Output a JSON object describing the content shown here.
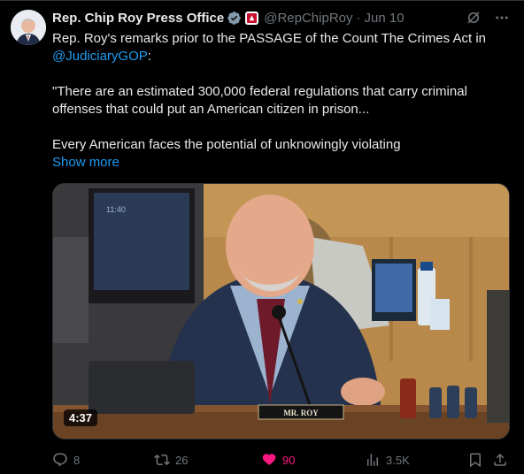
{
  "author": {
    "name": "Rep. Chip Roy Press Office",
    "handle": "@RepChipRoy",
    "date": "Jun 10",
    "avatar_icon": "person-avatar"
  },
  "tweet": {
    "line1": "Rep. Roy's remarks prior to the PASSAGE of the Count The Crimes Act in",
    "mention": "@JudiciaryGOP",
    "mention_suffix": ":",
    "quote_line1": "\"There are an estimated 300,000 federal regulations that carry criminal",
    "quote_line2": "offenses that could put an American citizen in prison...",
    "line_last": "Every American faces the potential of unknowingly violating",
    "show_more": "Show more"
  },
  "video": {
    "duration": "4:37",
    "nameplate": "MR. ROY",
    "monitor_text": "11:40"
  },
  "actions": {
    "replies": "8",
    "reposts": "26",
    "likes": "90",
    "views": "3.5K"
  },
  "colors": {
    "background": "#000000",
    "accent": "#1d9bf0",
    "muted": "#71767b",
    "like": "#f91880",
    "verified": "#829aab"
  }
}
